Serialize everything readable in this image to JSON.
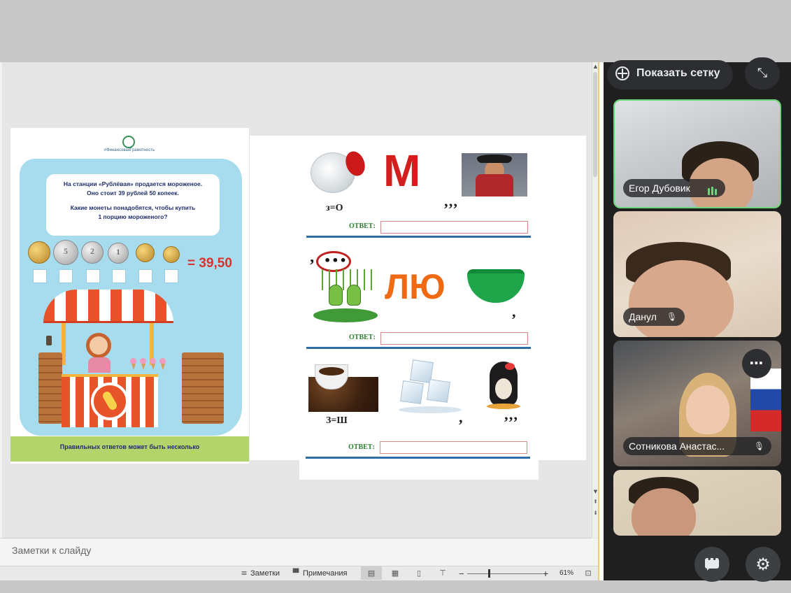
{
  "worksheet_left": {
    "logo_text": "#ФинансоваяГрамотность",
    "task_lines": [
      "На станции «Рублёвая» продается мороженое.",
      "Оно стоит 39 рублей 50 копеек.",
      "",
      "Какие монеты понадобятся, чтобы купить",
      "1 порцию мороженого?"
    ],
    "coins": [
      "",
      "5",
      "2",
      "1",
      "",
      ""
    ],
    "sum": "= 39,50",
    "footer": "Правильных ответов может быть несколько"
  },
  "worksheet_right": {
    "row1": {
      "letter": "М",
      "equation": "з=О",
      "commas": "’’’",
      "answer_label": "ОТВЕТ:"
    },
    "row2": {
      "comma_left": "’",
      "dots": "•••",
      "letters": "ЛЮ",
      "comma_right": ",",
      "answer_label": "ОТВЕТ:"
    },
    "row3": {
      "equation": "З=Ш",
      "comma_mid": ",",
      "commas": "’’’",
      "answer_label": "ОТВЕТ:"
    }
  },
  "notes": {
    "placeholder": "Заметки к слайду"
  },
  "statusbar": {
    "notes_label": "Заметки",
    "comments_label": "Примечания",
    "zoom_minus": "−",
    "zoom_plus": "+",
    "zoom_level": "61%",
    "zoom_fraction": 0.28
  },
  "meet": {
    "show_grid_label": "Показать сетку",
    "participants": [
      {
        "name": "Егор Дубовик",
        "speaking": true
      },
      {
        "name": "Данул",
        "muted": true
      },
      {
        "name": "Сотникова Анастас...",
        "muted": true
      },
      {
        "name": ""
      }
    ],
    "icons": {
      "collapse": "collapse-icon",
      "more": "more-options-icon",
      "chat": "chat-icon",
      "settings": "settings-icon"
    }
  }
}
